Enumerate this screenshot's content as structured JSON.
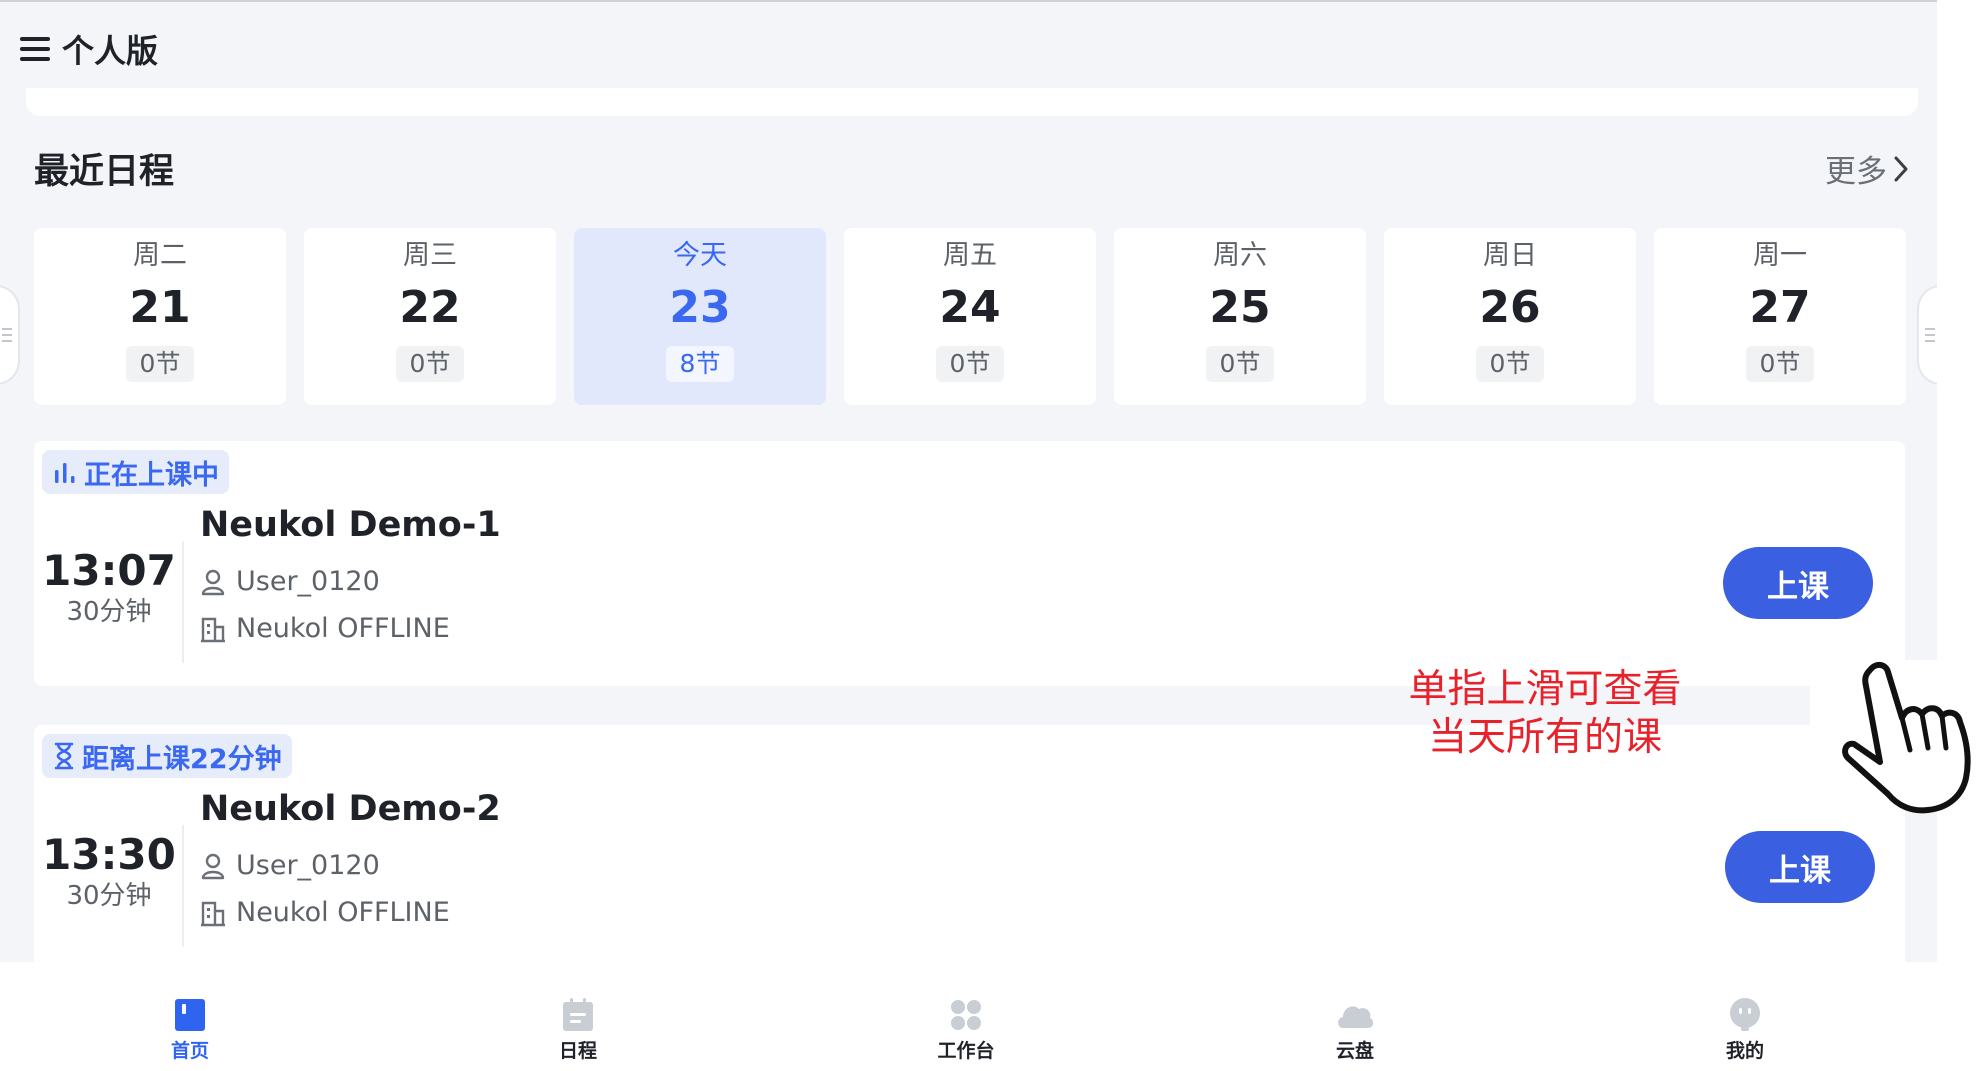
{
  "header": {
    "title": "个人版"
  },
  "recent": {
    "title": "最近日程",
    "more_label": "更多"
  },
  "days": [
    {
      "week": "周二",
      "date": "21",
      "count": "0节",
      "selected": false
    },
    {
      "week": "周三",
      "date": "22",
      "count": "0节",
      "selected": false
    },
    {
      "week": "今天",
      "date": "23",
      "count": "8节",
      "selected": true
    },
    {
      "week": "周五",
      "date": "24",
      "count": "0节",
      "selected": false
    },
    {
      "week": "周六",
      "date": "25",
      "count": "0节",
      "selected": false
    },
    {
      "week": "周日",
      "date": "26",
      "count": "0节",
      "selected": false
    },
    {
      "week": "周一",
      "date": "27",
      "count": "0节",
      "selected": false
    }
  ],
  "lessons": [
    {
      "status": "正在上课中",
      "status_icon": "bar-chart-icon",
      "time": "13:07",
      "duration": "30分钟",
      "name": "Neukol Demo-1",
      "teacher": "User_0120",
      "org": "Neukol OFFLINE",
      "action": "上课"
    },
    {
      "status": "距离上课22分钟",
      "status_icon": "hourglass-icon",
      "time": "13:30",
      "duration": "30分钟",
      "name": "Neukol Demo-2",
      "teacher": "User_0120",
      "org": "Neukol OFFLINE",
      "action": "上课"
    }
  ],
  "hint": {
    "line1": "单指上滑可查看",
    "line2": "当天所有的课"
  },
  "nav": [
    {
      "label": "首页",
      "icon": "home-book-icon",
      "active": true
    },
    {
      "label": "日程",
      "icon": "calendar-icon",
      "active": false
    },
    {
      "label": "工作台",
      "icon": "workbench-grid-icon",
      "active": false
    },
    {
      "label": "云盘",
      "icon": "cloud-icon",
      "active": false
    },
    {
      "label": "我的",
      "icon": "profile-icon",
      "active": false
    }
  ],
  "colors": {
    "primary": "#3a5fe0",
    "today_bg": "#e1e8fb",
    "hint_red": "#e8222b",
    "page_bg": "#f4f5f8"
  }
}
